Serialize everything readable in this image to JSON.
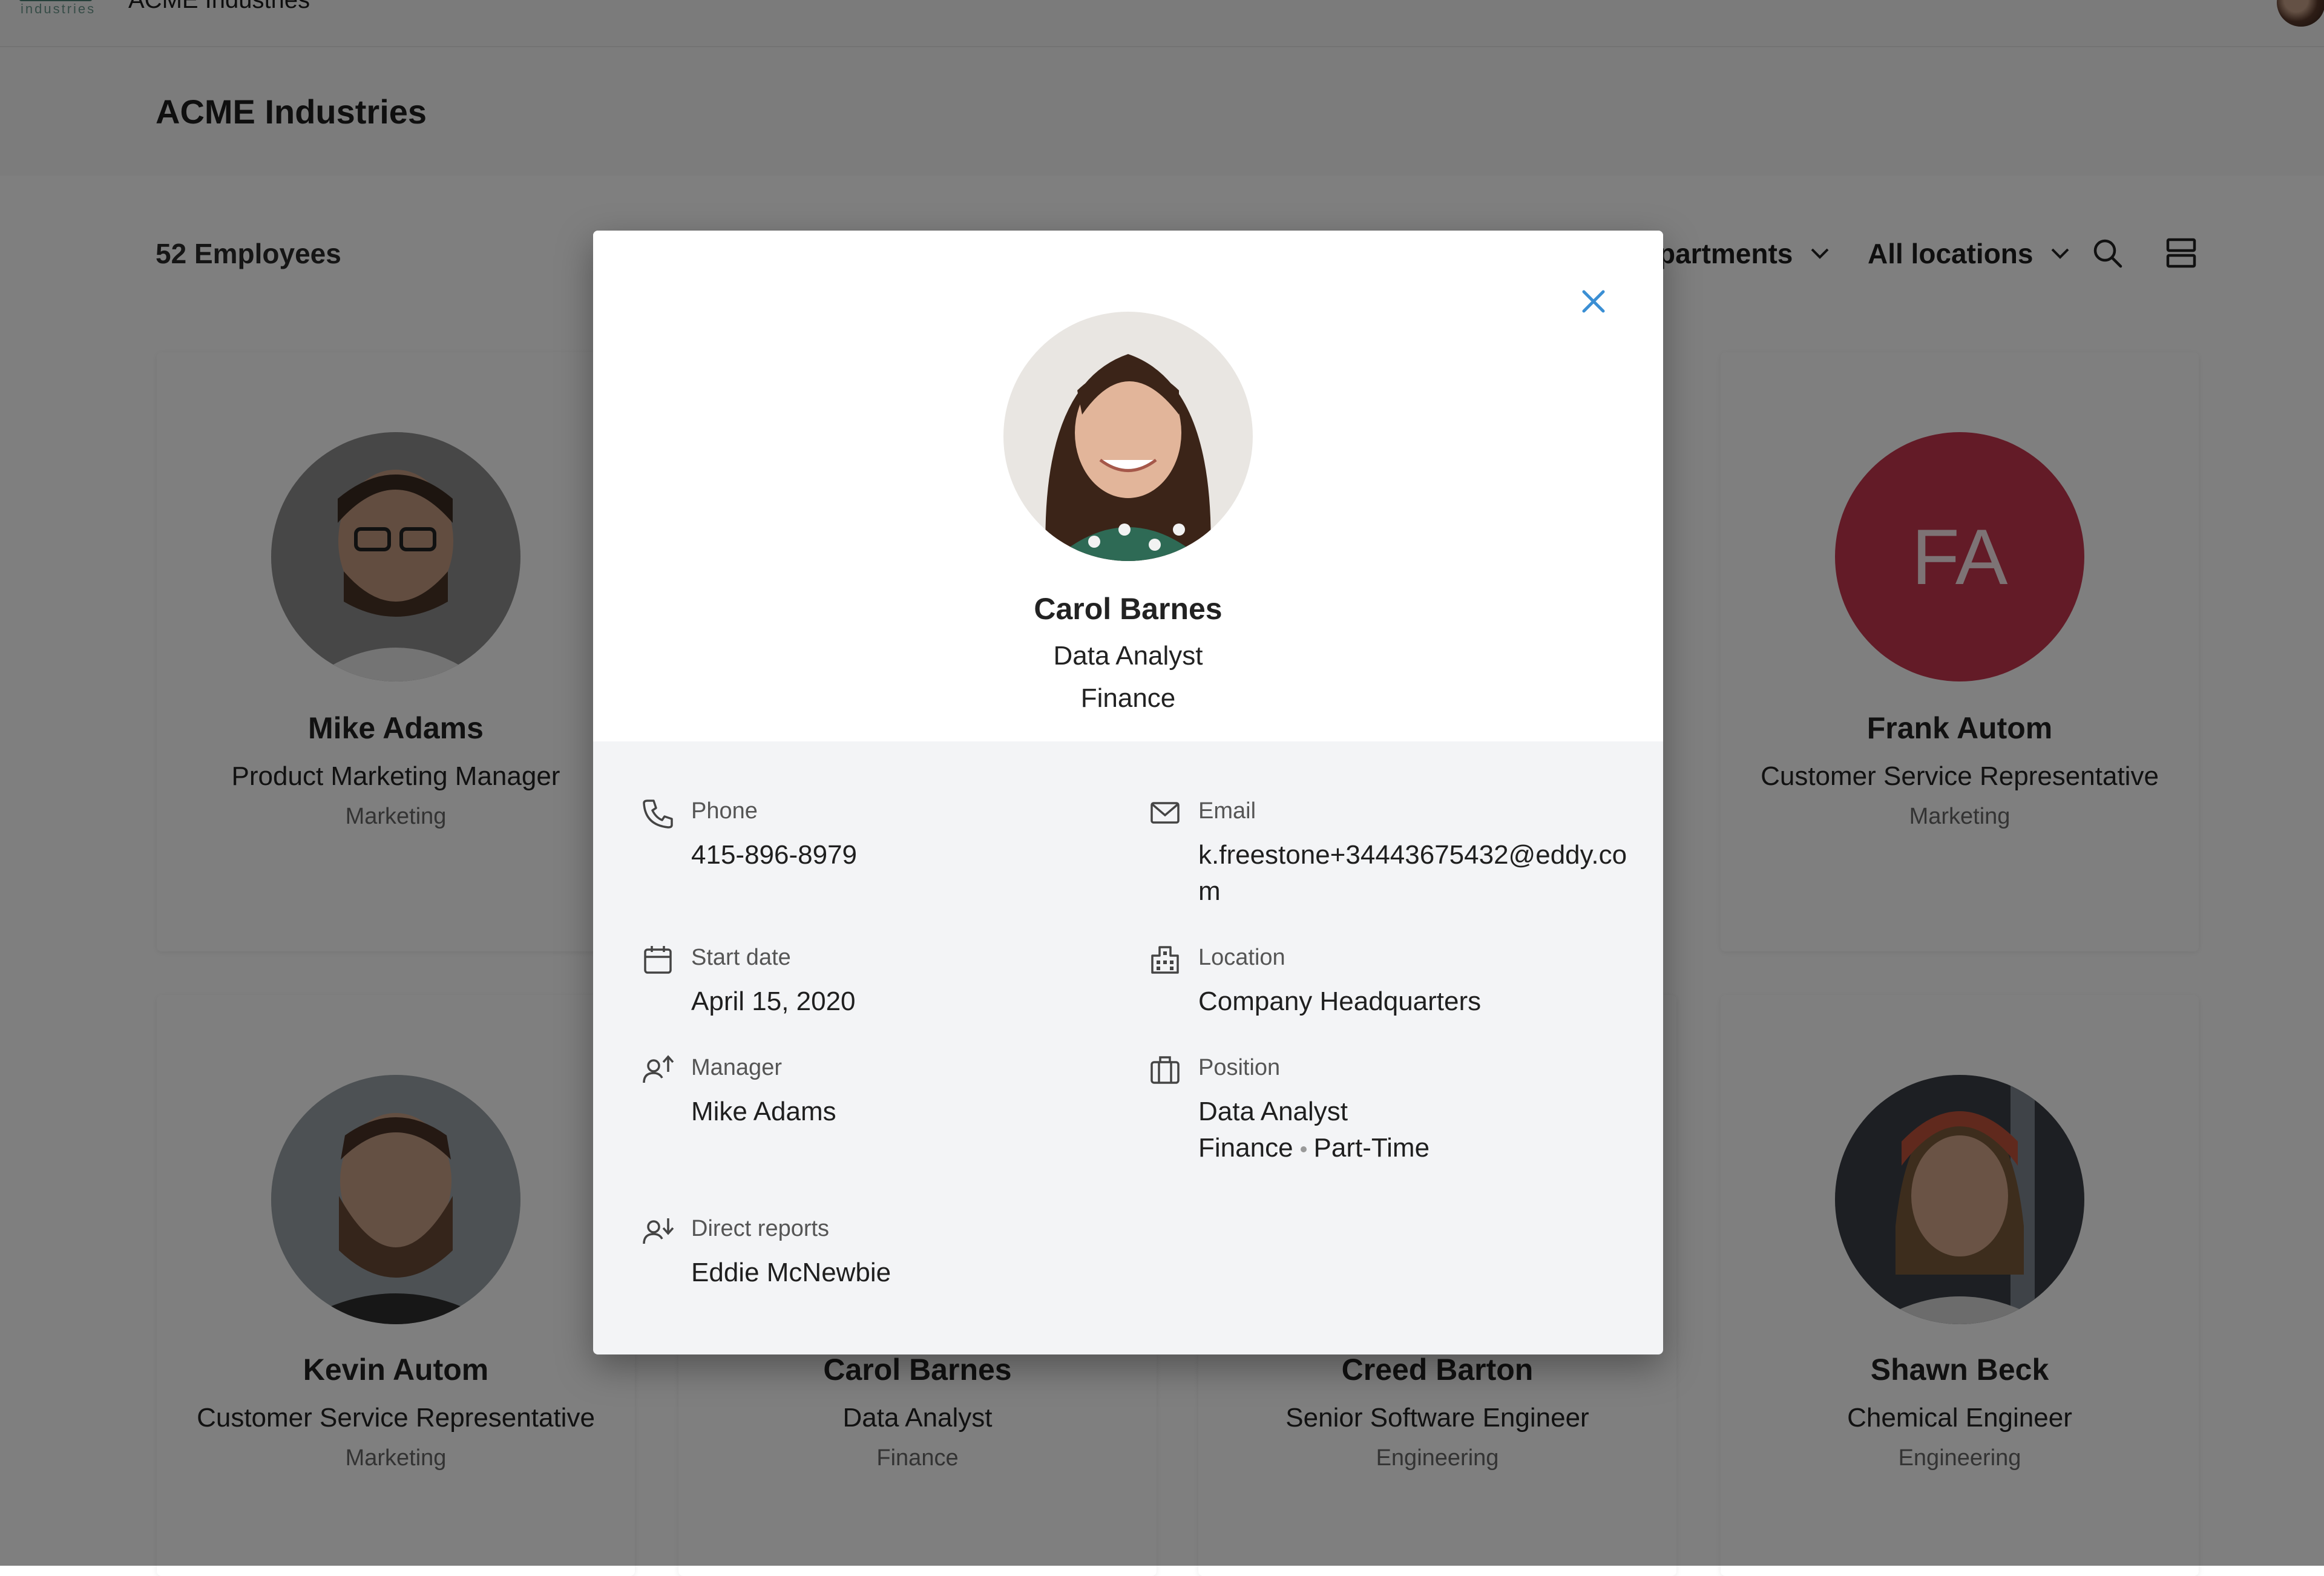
{
  "app": {
    "logo_text": "industries",
    "top_title": "ACME Industries",
    "company_name": "ACME Industries",
    "employee_count": "52 Employees"
  },
  "filters": {
    "departments": "partments",
    "locations": "All locations"
  },
  "cards": [
    {
      "name": "Mike Adams",
      "title": "Product Marketing Manager",
      "dept": "Marketing"
    },
    {
      "name": "Frank Autom",
      "title": "Customer Service Representative",
      "dept": "Marketing",
      "initials": "FA"
    },
    {
      "name": "Kevin Autom",
      "title": "Customer Service Representative",
      "dept": "Marketing"
    },
    {
      "name": "Carol Barnes",
      "title": "Data Analyst",
      "dept": "Finance"
    },
    {
      "name": "Creed Barton",
      "title": "Senior Software Engineer",
      "dept": "Engineering"
    },
    {
      "name": "Shawn Beck",
      "title": "Chemical Engineer",
      "dept": "Engineering"
    }
  ],
  "modal": {
    "name": "Carol Barnes",
    "title": "Data Analyst",
    "department": "Finance",
    "phone_label": "Phone",
    "phone": "415-896-8979",
    "email_label": "Email",
    "email_line1": "k.freestone+34443675432@eddy.co",
    "email_line2": "m",
    "start_label": "Start date",
    "start_date": "April 15, 2020",
    "location_label": "Location",
    "location": "Company Headquarters",
    "manager_label": "Manager",
    "manager": "Mike Adams",
    "position_label": "Position",
    "position_title": "Data Analyst",
    "position_dept": "Finance",
    "position_type": "Part-Time",
    "reports_label": "Direct reports",
    "reports": "Eddie McNewbie"
  },
  "colors": {
    "accent": "#3b8fd4",
    "initials_bg": "#c7374f",
    "overlay": "rgba(0,0,0,0.5)"
  }
}
